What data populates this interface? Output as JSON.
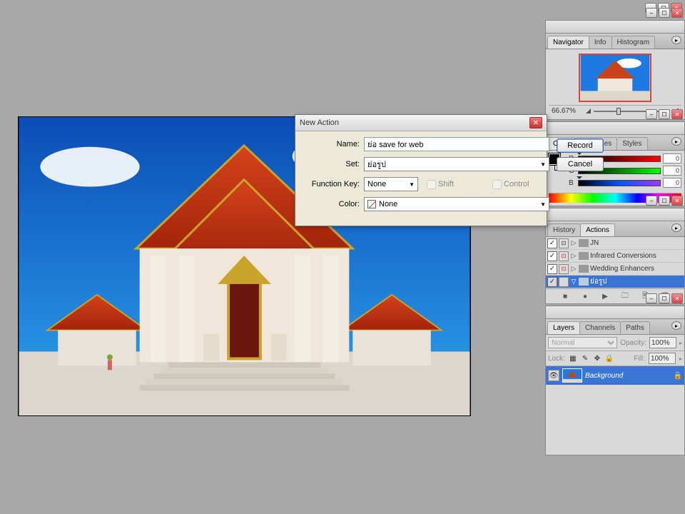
{
  "navigator": {
    "tabs": [
      "Navigator",
      "Info",
      "Histogram"
    ],
    "zoom": "66.67%"
  },
  "color": {
    "tabs": [
      "Color",
      "Swatches",
      "Styles"
    ],
    "r_label": "R",
    "g_label": "G",
    "b_label": "B",
    "r": "0",
    "g": "0",
    "b": "0"
  },
  "actions": {
    "tabs": [
      "History",
      "Actions"
    ],
    "items": [
      {
        "name": "JN",
        "dlg": "plain"
      },
      {
        "name": "Infrared Conversions",
        "dlg": "red"
      },
      {
        "name": "Wedding Enhancers",
        "dlg": "red"
      },
      {
        "name": "ย่อรูป",
        "dlg": "none",
        "selected": true,
        "open": true
      }
    ]
  },
  "layers": {
    "tabs": [
      "Layers",
      "Channels",
      "Paths"
    ],
    "blend": "Normal",
    "opacity_label": "Opacity:",
    "opacity": "100%",
    "lock_label": "Lock:",
    "fill_label": "Fill:",
    "fill": "100%",
    "layer_name": "Background"
  },
  "dialog": {
    "title": "New Action",
    "name_label": "Name:",
    "name_value": "ย่อ save for web",
    "set_label": "Set:",
    "set_value": "ย่อรูป",
    "fkey_label": "Function Key:",
    "fkey_value": "None",
    "shift_label": "Shift",
    "control_label": "Control",
    "color_label": "Color:",
    "color_value": "None",
    "record": "Record",
    "cancel": "Cancel"
  }
}
